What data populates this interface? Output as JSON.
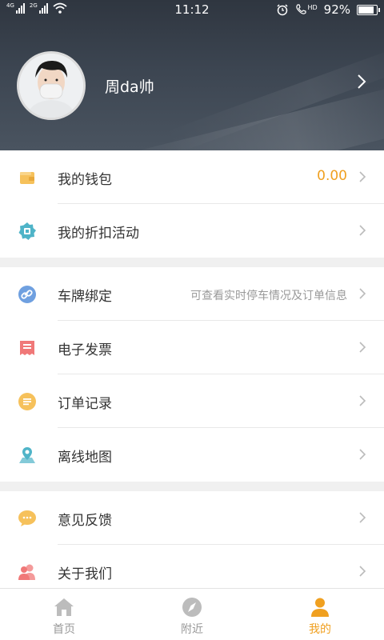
{
  "status_bar": {
    "sim1_tag": "4G",
    "sim2_tag": "2G",
    "time": "11:12",
    "hd_tag": "HD",
    "battery_text": "92%",
    "battery_level": 0.92
  },
  "profile": {
    "username": "周da帅"
  },
  "groups": [
    {
      "items": [
        {
          "label": "我的钱包",
          "value": "0.00",
          "icon": "wallet-icon",
          "color": "#f6c15b"
        },
        {
          "label": "我的折扣活动",
          "icon": "discount-badge-icon",
          "color": "#4fb4c8"
        }
      ]
    },
    {
      "items": [
        {
          "label": "车牌绑定",
          "hint": "可查看实时停车情况及订单信息",
          "icon": "link-icon",
          "color": "#6fa0e0"
        },
        {
          "label": "电子发票",
          "icon": "invoice-icon",
          "color": "#f07878"
        },
        {
          "label": "订单记录",
          "icon": "order-list-icon",
          "color": "#f6c15b"
        },
        {
          "label": "离线地图",
          "icon": "map-pin-icon",
          "color": "#4fb4c8"
        }
      ]
    },
    {
      "items": [
        {
          "label": "意见反馈",
          "icon": "chat-bubble-icon",
          "color": "#f6c15b"
        },
        {
          "label": "关于我们",
          "icon": "people-icon",
          "color": "#f07878"
        }
      ]
    }
  ],
  "tabs": [
    {
      "label": "首页",
      "icon": "home-icon",
      "active": false
    },
    {
      "label": "附近",
      "icon": "compass-icon",
      "active": false
    },
    {
      "label": "我的",
      "icon": "user-icon",
      "active": true
    }
  ],
  "colors": {
    "accent": "#f0a020",
    "inactive": "#999999"
  }
}
